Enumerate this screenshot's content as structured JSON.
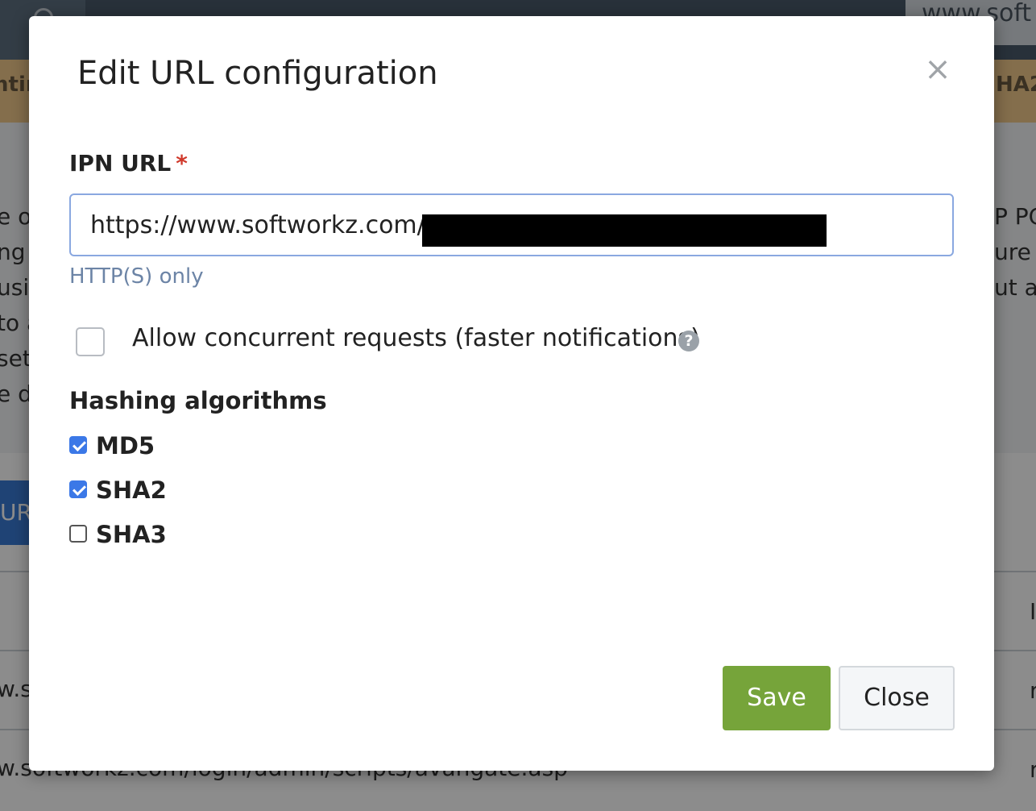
{
  "background": {
    "url_fragment": "www.soft",
    "orange_left": "ntir",
    "orange_right": "HA2",
    "left_text_lines": [
      "e o",
      "ng",
      "usi",
      "to a",
      "set",
      "e d"
    ],
    "right_text_lines": [
      "P PC",
      "ure f",
      "ut ar"
    ],
    "button_fragment": "URL",
    "row_cells": [
      "w.s",
      "w.softworkz.com/login/admin/scripts/avangate.asp"
    ],
    "right_cells": [
      "I",
      "r",
      "r"
    ]
  },
  "modal": {
    "title": "Edit URL configuration",
    "close_symbol": "×",
    "ipn_url": {
      "label": "IPN URL",
      "required_marker": "*",
      "value": "https://www.softworkz.com/",
      "help": "HTTP(S) only"
    },
    "concurrent": {
      "label": "Allow concurrent requests (faster notifications)",
      "checked": false,
      "help_symbol": "?"
    },
    "hashing": {
      "heading": "Hashing algorithms",
      "options": [
        {
          "label": "MD5",
          "checked": true
        },
        {
          "label": "SHA2",
          "checked": true
        },
        {
          "label": "SHA3",
          "checked": false
        }
      ]
    },
    "buttons": {
      "save": "Save",
      "close": "Close"
    },
    "colors": {
      "save_button": "#76a43a",
      "checkbox_accent": "#3b78e7",
      "required_star": "#d0392b",
      "help_text": "#6c84a6"
    }
  }
}
